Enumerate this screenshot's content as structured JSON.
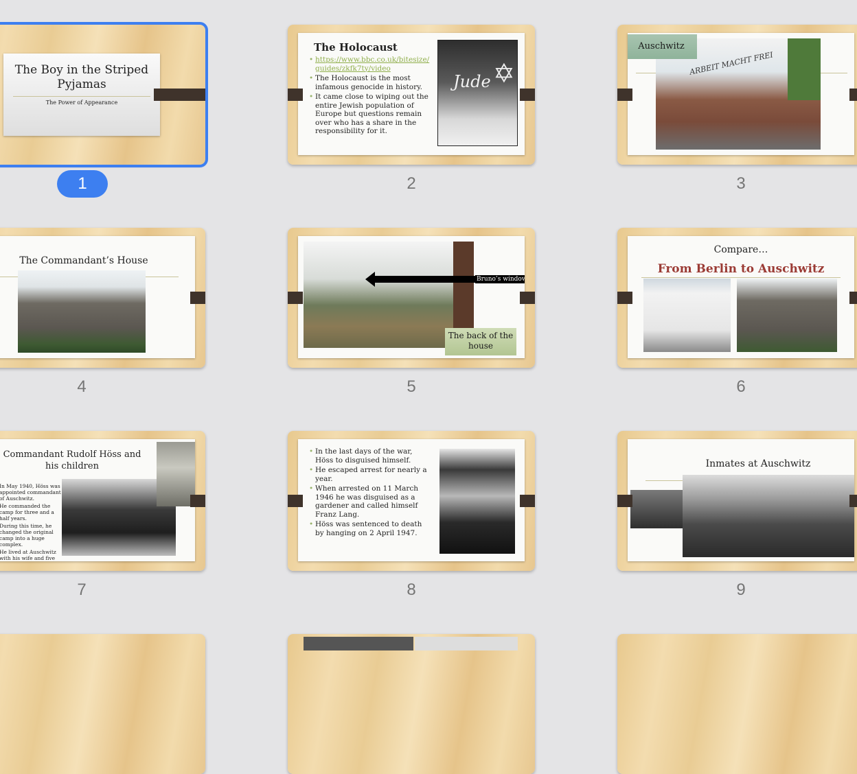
{
  "slides": [
    {
      "number": "1",
      "title": "The Boy in the Striped Pyjamas",
      "subtitle": "The Power of Appearance"
    },
    {
      "number": "2",
      "title": "The Holocaust",
      "bullets": [
        "https://www.bbc.co.uk/bitesize/guides/zkfk7ty/video",
        "The Holocaust is the most infamous genocide in history.",
        "It came close to wiping out the entire Jewish population of Europe but questions remain over who has a share in the responsibility for it."
      ],
      "photo_text": "Jude"
    },
    {
      "number": "3",
      "title": "Auschwitz",
      "photo_text": "ARBEIT MACHT FREI"
    },
    {
      "number": "4",
      "title": "The Commandant’s House"
    },
    {
      "number": "5",
      "arrow_label": "Bruno’s window?",
      "caption": "The back of the house"
    },
    {
      "number": "6",
      "title": "Compare…",
      "subtitle": "From Berlin to Auschwitz"
    },
    {
      "number": "7",
      "title": "Commandant Rudolf Höss and his children",
      "bullets": [
        "In May 1940, Höss was appointed commandant of Auschwitz.",
        "He commanded the camp for three and a half years.",
        "During this time, he changed the original camp into a huge complex.",
        "He lived at Auschwitz with his wife and five children."
      ]
    },
    {
      "number": "8",
      "bullets": [
        "In the last days of the war, Höss to disguised himself.",
        "He escaped arrest for nearly a year.",
        "When arrested on 11 March 1946 he was disguised as a gardener and called himself Franz Lang.",
        "Höss was sentenced to death by hanging on 2 April 1947."
      ]
    },
    {
      "number": "9",
      "title": "Inmates at Auschwitz"
    }
  ],
  "colors": {
    "selection": "#3d7ff0",
    "accent_title": "#9b3b35",
    "bullet": "#98b36a"
  }
}
